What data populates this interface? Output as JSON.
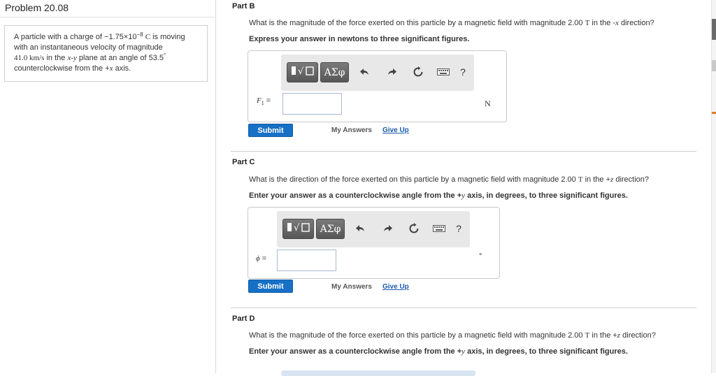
{
  "problem": {
    "title": "Problem 20.08",
    "statement": {
      "line1_pre": "A particle with a charge of −1.75×10",
      "line1_exp": "−8",
      "line1_unit": "C",
      "line1_post": " is moving",
      "line2": "with an instantaneous velocity of magnitude",
      "line3_num": "41.0 ",
      "line3_unit": "km/s",
      "line3_mid": " in the ",
      "line3_plane": "x-y",
      "line3_post": " plane at an angle of 53.5",
      "line3_deg": "°",
      "line4_pre": "counterclockwise from the +",
      "line4_axis": "x",
      "line4_post": " axis."
    }
  },
  "parts": [
    {
      "label": "Part B",
      "question_pre": "What is the magnitude of the force exerted on this particle by a magnetic field with magnitude 2.00 ",
      "question_unit": "T",
      "question_mid": " in the -",
      "question_axis": "x",
      "question_post": " direction?",
      "instruction": "Express your answer in newtons to three significant figures.",
      "var_name": "F",
      "var_sub": "1",
      "var_eq": " =",
      "unit": "N",
      "input_value": "",
      "submit_label": "Submit",
      "my_answers_label": "My Answers",
      "give_up_label": "Give Up"
    },
    {
      "label": "Part C",
      "question_pre": "What is the direction of the force exerted on this particle by a magnetic field with magnitude 2.00 ",
      "question_unit": "T",
      "question_mid": " in the +",
      "question_axis": "z",
      "question_post": " direction?",
      "instruction_pre": "Enter your answer as a counterclockwise angle from the +",
      "instruction_axis": "y",
      "instruction_post": " axis, in degrees, to three significant figures.",
      "var_name": "ϕ",
      "var_eq": " =",
      "unit": "°",
      "input_value": "",
      "submit_label": "Submit",
      "my_answers_label": "My Answers",
      "give_up_label": "Give Up"
    },
    {
      "label": "Part D",
      "question_pre": "What is the magnitude of the force exerted on this particle by a magnetic field with magnitude 2.00 ",
      "question_unit": "T",
      "question_mid": " in the +",
      "question_axis": "z",
      "question_post": " direction?",
      "instruction_pre": "Enter your answer as a counterclockwise angle from the +",
      "instruction_axis": "y",
      "instruction_post": " axis, in degrees, to three significant figures."
    }
  ],
  "toolbar": {
    "greek_label": "ΑΣφ",
    "help_label": "?",
    "icons": [
      "templates-icon",
      "greek-icon",
      "undo-icon",
      "redo-icon",
      "reset-icon",
      "keyboard-icon",
      "help-icon"
    ]
  },
  "colors": {
    "submit_bg": "#1770c6",
    "link": "#1a5bb0",
    "toolbar_button": "#666666",
    "scroll_accent": "#e07b23"
  }
}
